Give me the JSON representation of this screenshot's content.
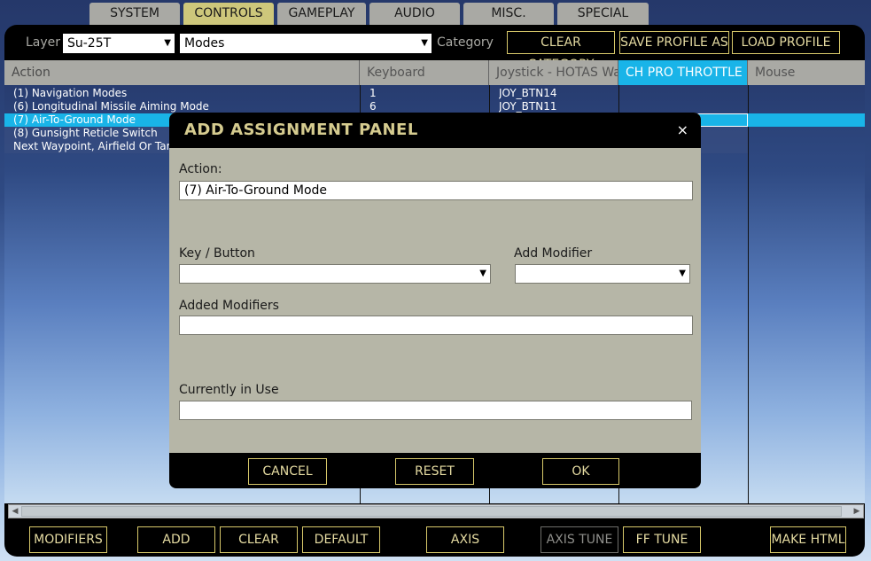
{
  "tabs": [
    "SYSTEM",
    "CONTROLS",
    "GAMEPLAY",
    "AUDIO",
    "MISC.",
    "SPECIAL"
  ],
  "active_tab": "CONTROLS",
  "toolbar": {
    "layer_label": "Layer",
    "layer_value": "Su-25T",
    "modes_value": "Modes",
    "category_label": "Category",
    "clear_category": "CLEAR CATEGORY",
    "save_profile_as": "SAVE PROFILE AS",
    "load_profile": "LOAD PROFILE"
  },
  "table": {
    "columns": [
      "Action",
      "Keyboard",
      "Joystick - HOTAS Wa",
      "CH PRO THROTTLE U",
      "Mouse"
    ],
    "active_column": "CH PRO THROTTLE U",
    "rows": [
      {
        "action": "(1) Navigation Modes",
        "keyboard": "1",
        "joystick": "JOY_BTN14",
        "selected": false
      },
      {
        "action": "(6) Longitudinal Missile Aiming Mode",
        "keyboard": "6",
        "joystick": "JOY_BTN11",
        "selected": false
      },
      {
        "action": "(7) Air-To-Ground Mode",
        "keyboard": "",
        "joystick": "",
        "selected": true
      },
      {
        "action": "(8) Gunsight Reticle Switch",
        "keyboard": "",
        "joystick": "",
        "selected": false
      },
      {
        "action": "Next Waypoint, Airfield Or Target",
        "keyboard": "",
        "joystick": "",
        "selected": false
      }
    ]
  },
  "bottom_buttons": {
    "modifiers": "MODIFIERS",
    "add": "ADD",
    "clear": "CLEAR",
    "default": "DEFAULT",
    "axis_assign": "AXIS ASSIGN",
    "axis_tune": "AXIS TUNE",
    "ff_tune": "FF TUNE",
    "make_html": "MAKE HTML"
  },
  "modal": {
    "title": "ADD ASSIGNMENT PANEL",
    "close": "×",
    "action_label": "Action:",
    "action_value": "(7) Air-To-Ground Mode",
    "key_button_label": "Key / Button",
    "key_button_value": "",
    "add_modifier_label": "Add Modifier",
    "add_modifier_value": "",
    "added_modifiers_label": "Added Modifiers",
    "added_modifiers_value": "",
    "currently_in_use_label": "Currently in Use",
    "currently_in_use_value": "",
    "cancel": "CANCEL",
    "reset": "RESET",
    "ok": "OK"
  }
}
